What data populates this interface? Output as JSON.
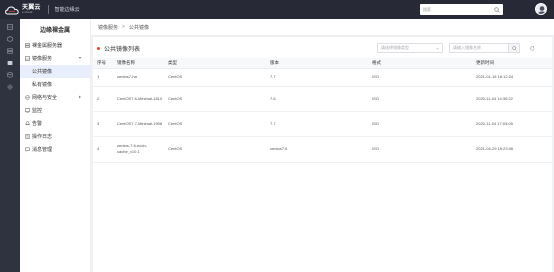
{
  "topbar": {
    "brand_cn": "天翼云",
    "brand_en": "e Cloud",
    "product": "智能边缘云",
    "search_placeholder": "搜索"
  },
  "sidebar": {
    "title": "边缘裸金属",
    "items": [
      {
        "label": "裸金属服务器",
        "icon": "server-icon"
      },
      {
        "label": "镜像服务",
        "icon": "image-icon",
        "expanded": true,
        "children": [
          {
            "label": "公共镜像",
            "active": true
          },
          {
            "label": "私有镜像",
            "active": false
          }
        ]
      },
      {
        "label": "网络与安全",
        "icon": "network-icon",
        "has_arrow": true
      },
      {
        "label": "监控",
        "icon": "monitor-icon"
      },
      {
        "label": "告警",
        "icon": "bell-icon"
      },
      {
        "label": "操作日志",
        "icon": "log-icon"
      },
      {
        "label": "消息管理",
        "icon": "message-icon"
      }
    ]
  },
  "breadcrumb": {
    "parent": "镜像服务",
    "separator": ">",
    "current": "公共镜像"
  },
  "card": {
    "title": "公共镜像列表",
    "select_placeholder": "请选择镜像类型",
    "search_placeholder": "请输入镜像名称"
  },
  "table": {
    "headers": [
      "序号",
      "镜像名称",
      "类型",
      "版本",
      "格式",
      "更新时间"
    ],
    "rows": [
      {
        "idx": "1",
        "name": "centos7-ha",
        "type": "CentOS",
        "version": "7.7",
        "format": "ISO",
        "updated": "2021-01-15 18:12:24"
      },
      {
        "idx": "2",
        "name": "CentOS7.6-Minimal-1810",
        "type": "CentOS",
        "version": "7.6",
        "format": "ISO",
        "updated": "2020-11-04 14:30:22"
      },
      {
        "idx": "3",
        "name": "CentOS7.7-Minimal-1908",
        "type": "CentOS",
        "version": "7.7",
        "format": "ISO",
        "updated": "2020-11-04 17:03:05"
      },
      {
        "idx": "4",
        "name": "centos-7.6-ecdn-cache_v10.1",
        "type": "CentOS",
        "version": "centos7.6",
        "format": "ISO",
        "updated": "2021-04-29 15:23:06"
      }
    ]
  },
  "colors": {
    "topbar_bg": "#272a36",
    "rail_bg": "#2f3340",
    "active_bg": "#e8eefc",
    "accent_dot": "#e6462e"
  }
}
